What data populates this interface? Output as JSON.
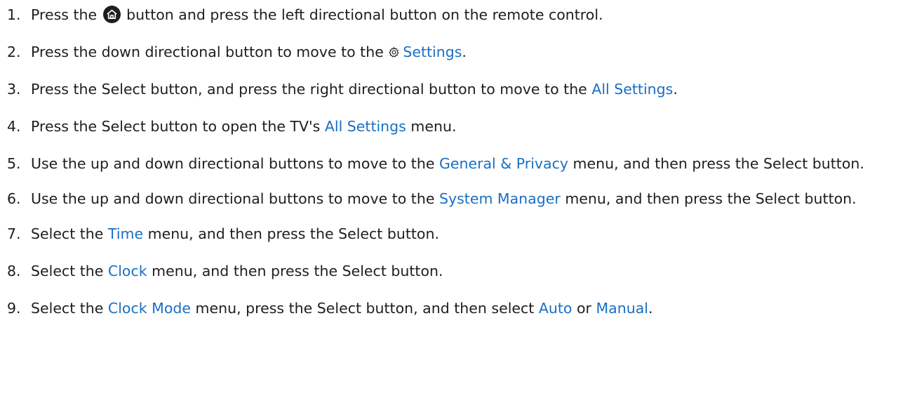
{
  "steps": [
    {
      "number": "1.",
      "parts": [
        {
          "text": "Press the "
        },
        {
          "icon": "home-icon"
        },
        {
          "text": " button and press the left directional button on the remote control."
        }
      ]
    },
    {
      "number": "2.",
      "parts": [
        {
          "text": "Press the down directional button to move to the "
        },
        {
          "icon": "gear-icon"
        },
        {
          "link": "Settings"
        },
        {
          "text": "."
        }
      ]
    },
    {
      "number": "3.",
      "parts": [
        {
          "text": "Press the Select button, and press the right directional button to move to the "
        },
        {
          "link": "All Settings"
        },
        {
          "text": "."
        }
      ]
    },
    {
      "number": "4.",
      "parts": [
        {
          "text": "Press the Select button to open the TV's "
        },
        {
          "link": "All Settings"
        },
        {
          "text": " menu."
        }
      ]
    },
    {
      "number": "5.",
      "parts": [
        {
          "text": "Use the up and down directional buttons to move to the "
        },
        {
          "link": "General & Privacy"
        },
        {
          "text": " menu, and then press the Select button."
        }
      ]
    },
    {
      "number": "6.",
      "parts": [
        {
          "text": "Use the up and down directional buttons to move to the "
        },
        {
          "link": "System Manager"
        },
        {
          "text": " menu, and then press the Select button."
        }
      ]
    },
    {
      "number": "7.",
      "parts": [
        {
          "text": "Select the "
        },
        {
          "link": "Time"
        },
        {
          "text": " menu, and then press the Select button."
        }
      ]
    },
    {
      "number": "8.",
      "parts": [
        {
          "text": "Select the "
        },
        {
          "link": "Clock"
        },
        {
          "text": " menu, and then press the Select button."
        }
      ]
    },
    {
      "number": "9.",
      "parts": [
        {
          "text": "Select the "
        },
        {
          "link": "Clock Mode"
        },
        {
          "text": " menu, press the Select button, and then select "
        },
        {
          "link": "Auto"
        },
        {
          "text": " or "
        },
        {
          "link": "Manual"
        },
        {
          "text": "."
        }
      ]
    }
  ],
  "colors": {
    "text": "#1e1e1e",
    "menu_link": "#1a6fc4",
    "home_icon_fill": "#1e1e1e"
  }
}
